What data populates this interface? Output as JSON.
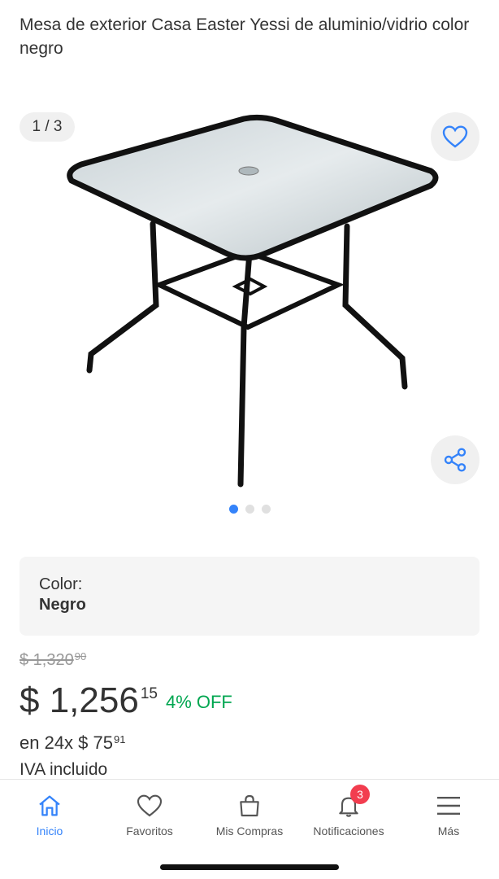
{
  "product": {
    "title": "Mesa de exterior Casa Easter Yessi de aluminio/vidrio color negro"
  },
  "gallery": {
    "counter": "1 / 3",
    "image_count": 3,
    "active_index": 0,
    "favorite_icon": "heart-icon",
    "share_icon": "share-icon"
  },
  "variant": {
    "label": "Color:",
    "value": "Negro"
  },
  "pricing": {
    "original_price": "$ 1,320",
    "original_cents": "90",
    "price": "$ 1,256",
    "price_cents": "15",
    "discount": "4% OFF",
    "installments": "en 24x $ 75",
    "installments_cents": "91",
    "tax_note": "IVA incluido"
  },
  "bottom_nav": {
    "items": [
      {
        "label": "Inicio",
        "icon": "home-icon",
        "active": true
      },
      {
        "label": "Favoritos",
        "icon": "heart-icon",
        "active": false
      },
      {
        "label": "Mis Compras",
        "icon": "bag-icon",
        "active": false
      },
      {
        "label": "Notificaciones",
        "icon": "bell-icon",
        "active": false,
        "badge": "3"
      },
      {
        "label": "Más",
        "icon": "menu-icon",
        "active": false
      }
    ]
  },
  "colors": {
    "accent": "#3483fa",
    "discount": "#00a650",
    "badge": "#f23d4f"
  }
}
